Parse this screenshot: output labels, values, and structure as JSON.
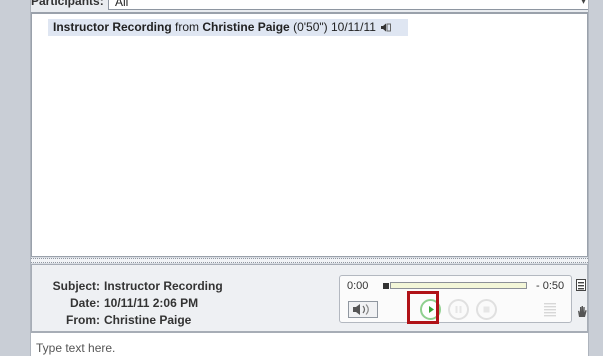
{
  "participants": {
    "label": "Participants:",
    "value": "All"
  },
  "message": {
    "title": "Instructor Recording",
    "from_word": "from",
    "sender": "Christine Paige",
    "duration": "(0'50\")",
    "date": "10/11/11"
  },
  "details": {
    "subject_label": "Subject:",
    "subject_value": "Instructor Recording",
    "date_label": "Date:",
    "date_value": "10/11/11 2:06 PM",
    "from_label": "From:",
    "from_value": "Christine Paige"
  },
  "player": {
    "time_start": "0:00",
    "time_remaining": "- 0:50",
    "progress": 0.0
  },
  "compose": {
    "placeholder": "Type text here."
  },
  "colors": {
    "highlight": "#b01217",
    "play_green": "#3aa63a",
    "list_selection": "#dfe6f2"
  },
  "icons": [
    "speaker-icon",
    "volume-icon",
    "play-icon",
    "pause-icon",
    "stop-icon",
    "menu-icon",
    "hand-icon",
    "level-meter-icon"
  ]
}
